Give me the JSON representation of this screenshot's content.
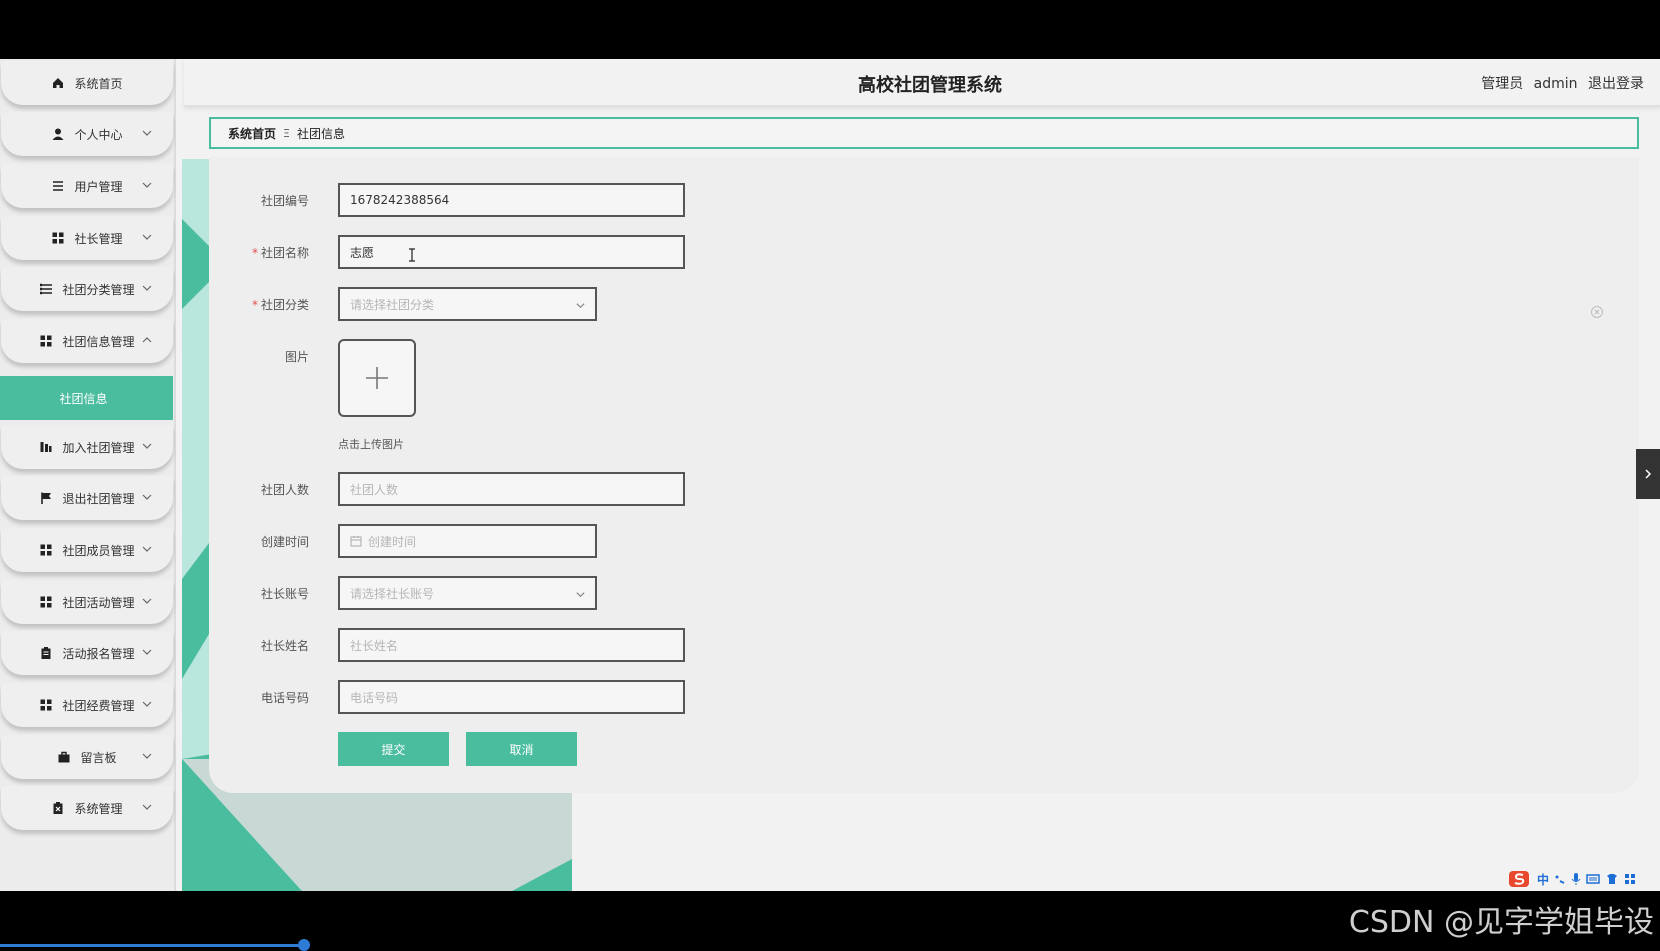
{
  "app": {
    "title": "高校社团管理系统",
    "user_role": "管理员",
    "user_name": "admin",
    "logout": "退出登录"
  },
  "sidebar": {
    "items": [
      {
        "label": "系统首页",
        "icon": "home-icon"
      },
      {
        "label": "个人中心",
        "icon": "user-icon"
      },
      {
        "label": "用户管理",
        "icon": "list-icon"
      },
      {
        "label": "社长管理",
        "icon": "grid-icon"
      },
      {
        "label": "社团分类管理",
        "icon": "menu-icon"
      },
      {
        "label": "社团信息管理",
        "icon": "grid-icon"
      },
      {
        "label": "加入社团管理",
        "icon": "chart-icon"
      },
      {
        "label": "退出社团管理",
        "icon": "flag-icon"
      },
      {
        "label": "社团成员管理",
        "icon": "grid-icon"
      },
      {
        "label": "社团活动管理",
        "icon": "grid-icon"
      },
      {
        "label": "活动报名管理",
        "icon": "clipboard-icon"
      },
      {
        "label": "社团经费管理",
        "icon": "grid-icon"
      },
      {
        "label": "留言板",
        "icon": "briefcase-icon"
      },
      {
        "label": "系统管理",
        "icon": "clipboard-x-icon"
      }
    ],
    "active_sub": "社团信息"
  },
  "breadcrumb": {
    "home": "系统首页",
    "separator": "Ξ",
    "current": "社团信息"
  },
  "form": {
    "club_no": {
      "label": "社团编号",
      "value": "1678242388564"
    },
    "club_name": {
      "label": "社团名称",
      "value": "志愿"
    },
    "club_category": {
      "label": "社团分类",
      "placeholder": "请选择社团分类"
    },
    "image": {
      "label": "图片",
      "hint": "点击上传图片"
    },
    "member_count": {
      "label": "社团人数",
      "placeholder": "社团人数"
    },
    "created_time": {
      "label": "创建时间",
      "placeholder": "创建时间"
    },
    "president_account": {
      "label": "社长账号",
      "placeholder": "请选择社长账号"
    },
    "president_name": {
      "label": "社长姓名",
      "placeholder": "社长姓名"
    },
    "phone": {
      "label": "电话号码",
      "placeholder": "电话号码"
    },
    "required_mark": "*",
    "submit": "提交",
    "cancel": "取消"
  },
  "ime": {
    "label": "中"
  },
  "watermark": "CSDN @见字学姐毕设",
  "colors": {
    "accent": "#4bbd9f",
    "page_bg": "#f2f2f2",
    "outer_bg": "#000000"
  }
}
